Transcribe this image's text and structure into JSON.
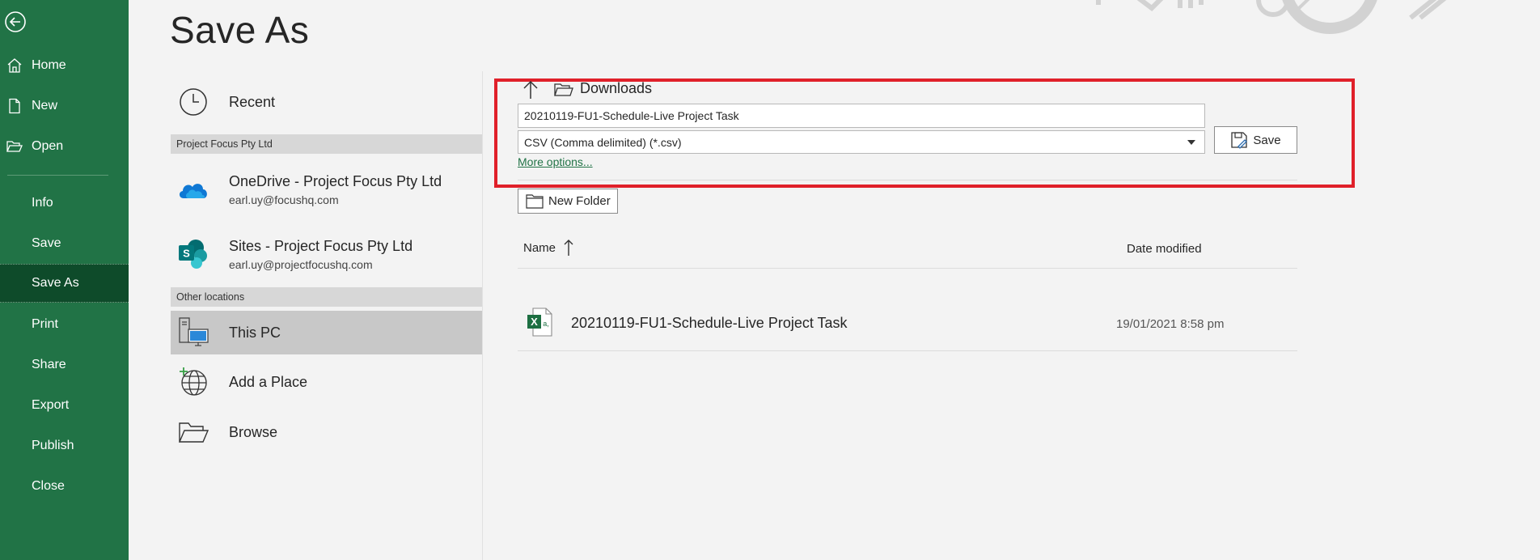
{
  "nav": {
    "items": [
      {
        "label": "Home",
        "icon": "home-icon"
      },
      {
        "label": "New",
        "icon": "new-document-icon"
      },
      {
        "label": "Open",
        "icon": "open-folder-icon"
      },
      {
        "label": "Info"
      },
      {
        "label": "Save"
      },
      {
        "label": "Save As",
        "selected": true
      },
      {
        "label": "Print"
      },
      {
        "label": "Share"
      },
      {
        "label": "Export"
      },
      {
        "label": "Publish"
      },
      {
        "label": "Close"
      }
    ]
  },
  "page": {
    "title": "Save As"
  },
  "locations": {
    "recent": "Recent",
    "section1": "Project Focus Pty Ltd",
    "onedrive": {
      "name": "OneDrive - Project Focus Pty Ltd",
      "email": "earl.uy@focushq.com"
    },
    "sites": {
      "name": "Sites - Project Focus Pty Ltd",
      "email": "earl.uy@projectfocushq.com"
    },
    "section2": "Other locations",
    "this_pc": "This PC",
    "add_place": "Add a Place",
    "browse": "Browse"
  },
  "save": {
    "current_folder": "Downloads",
    "filename": "20210119-FU1-Schedule-Live Project Task",
    "filetype": "CSV (Comma delimited) (*.csv)",
    "more_options": "More options...",
    "save_label": "Save",
    "new_folder_label": "New Folder"
  },
  "files": {
    "col_name": "Name",
    "col_date": "Date modified",
    "rows": [
      {
        "name": "20210119-FU1-Schedule-Live Project Task",
        "date": "19/01/2021 8:58 pm"
      }
    ]
  },
  "colors": {
    "nav_bg": "#217346",
    "nav_selected": "#0e4b2a",
    "highlight_box": "#e0202a",
    "link": "#217346"
  }
}
